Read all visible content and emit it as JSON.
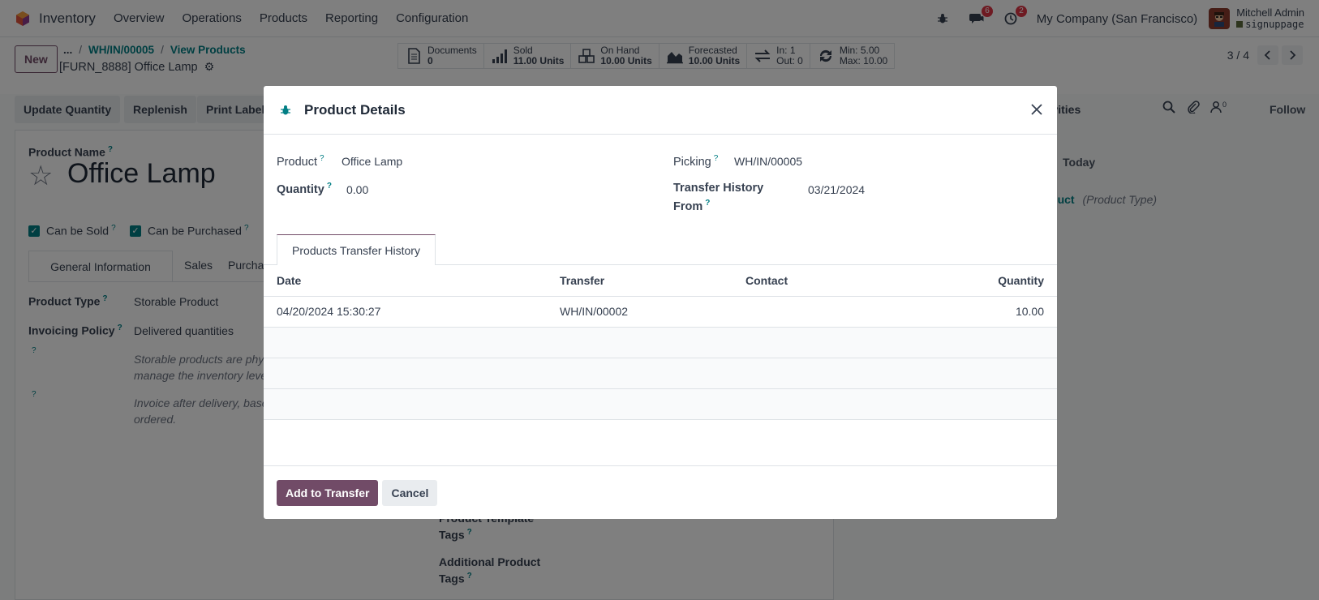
{
  "navbar": {
    "app_name": "Inventory",
    "menus": [
      "Overview",
      "Operations",
      "Products",
      "Reporting",
      "Configuration"
    ],
    "chat_count": "6",
    "activity_count": "2",
    "company": "My Company (San Francisco)",
    "user_name": "Mitchell Admin",
    "database": "signuppage"
  },
  "control": {
    "new_label": "New",
    "breadcrumb_dots": "...",
    "breadcrumb": [
      "WH/IN/00005",
      "View Products"
    ],
    "record_title": "[FURN_8888] Office Lamp",
    "stats": [
      {
        "icon": "documents-icon",
        "line1": "Documents",
        "line2": "0"
      },
      {
        "icon": "sold-chart-icon",
        "line1": "Sold",
        "line2": "11.00 Units"
      },
      {
        "icon": "on-hand-cubes-icon",
        "line1": "On Hand",
        "line2": "10.00 Units"
      },
      {
        "icon": "forecast-area-icon",
        "line1": "Forecasted",
        "line2": "10.00 Units"
      },
      {
        "icon": "in-out-arrows-icon",
        "line1": "In: 1",
        "line2": "Out: 0"
      },
      {
        "icon": "refresh-icon",
        "line1": "Min: 5.00",
        "line2": "Max: 10.00"
      }
    ],
    "pager": "3 / 4"
  },
  "background": {
    "buttons": [
      "Update Quantity",
      "Replenish",
      "Print Labels"
    ],
    "activities_label": "Activities",
    "follow_label": "Follow",
    "followers_count": "0",
    "product_name_label": "Product Name",
    "product_name": "Office Lamp",
    "can_be_sold": "Can be Sold",
    "can_be_purchased": "Can be Purchased",
    "tabs": [
      "General Information",
      "Sales",
      "Purchase"
    ],
    "product_type_label": "Product Type",
    "product_type_value": "Storable Product",
    "invoicing_policy_label": "Invoicing Policy",
    "invoicing_policy_value": "Delivered quantities",
    "help1_line1": "Storable products are phys",
    "help1_line2": "manage the inventory leve",
    "help2_line1": "Invoice after delivery, base",
    "help2_line2": "ordered.",
    "template_tags_label_1": "Product Template",
    "template_tags_label_2": "Tags",
    "additional_tags_label_1": "Additional Product",
    "additional_tags_label_2": "Tags",
    "today_label": "Today",
    "chatter_link": "e Product",
    "chatter_link_suffix": "(Product Type)",
    "help_mark": "?"
  },
  "modal": {
    "title": "Product Details",
    "product_label": "Product",
    "product_value": "Office Lamp",
    "quantity_label": "Quantity",
    "quantity_value": "0.00",
    "picking_label": "Picking",
    "picking_value": "WH/IN/00005",
    "history_from_label_1": "Transfer History",
    "history_from_label_2": "From",
    "history_from_value": "03/21/2024",
    "tab_label": "Products Transfer History",
    "columns": [
      "Date",
      "Transfer",
      "Contact",
      "Quantity"
    ],
    "rows": [
      {
        "date": "04/20/2024 15:30:27",
        "transfer": "WH/IN/00002",
        "contact": "",
        "quantity": "10.00"
      }
    ],
    "primary_button": "Add to Transfer",
    "cancel_button": "Cancel",
    "help_mark": "?"
  },
  "colors": {
    "brand": "#714b67",
    "link": "#017e84",
    "badge": "#dc3545"
  }
}
